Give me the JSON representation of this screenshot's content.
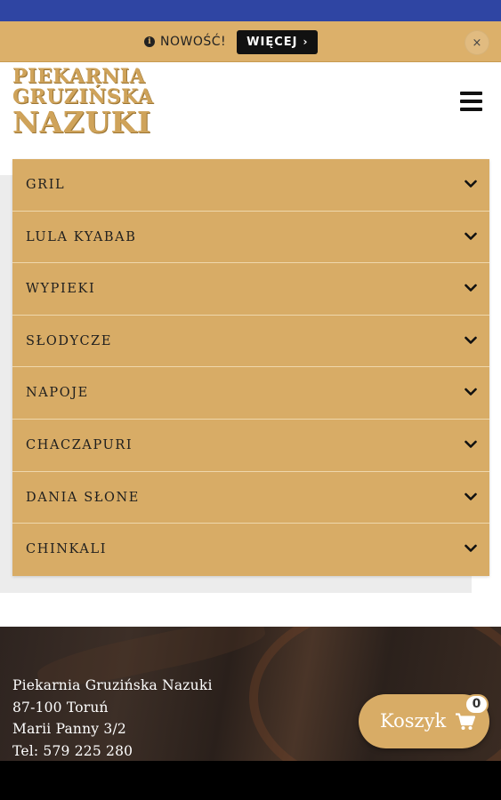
{
  "notice": {
    "text": "NOWOŚĆ!",
    "more_label": "WIĘCEJ",
    "more_chevron": "›",
    "close_label": "×"
  },
  "logo": {
    "line1": "PIEKARNIA",
    "line2": "GRUZIŃSKA",
    "line3": "NAZUKI"
  },
  "categories": [
    {
      "label": "GRIL"
    },
    {
      "label": "LULA KYABAB"
    },
    {
      "label": "WYPIEKI"
    },
    {
      "label": "SŁODYCZE"
    },
    {
      "label": "NAPOJE"
    },
    {
      "label": "CHACZAPURI"
    },
    {
      "label": "DANIA SŁONE"
    },
    {
      "label": "CHINKALI"
    }
  ],
  "footer": {
    "name": "Piekarnia Gruzińska Nazuki",
    "city": "87-100 Toruń",
    "street": "Marii Panny 3/2",
    "phone": "Tel: 579 225 280"
  },
  "cart": {
    "label": "Koszyk",
    "count": "0"
  },
  "icons": {
    "info": "info-icon",
    "menu": "hamburger-menu-icon",
    "chevron": "chevron-down-icon",
    "cart": "shopping-cart-icon"
  },
  "colors": {
    "status_bar": "#2f45a3",
    "accent": "#d8ac66",
    "logo": "#cfa35a"
  }
}
